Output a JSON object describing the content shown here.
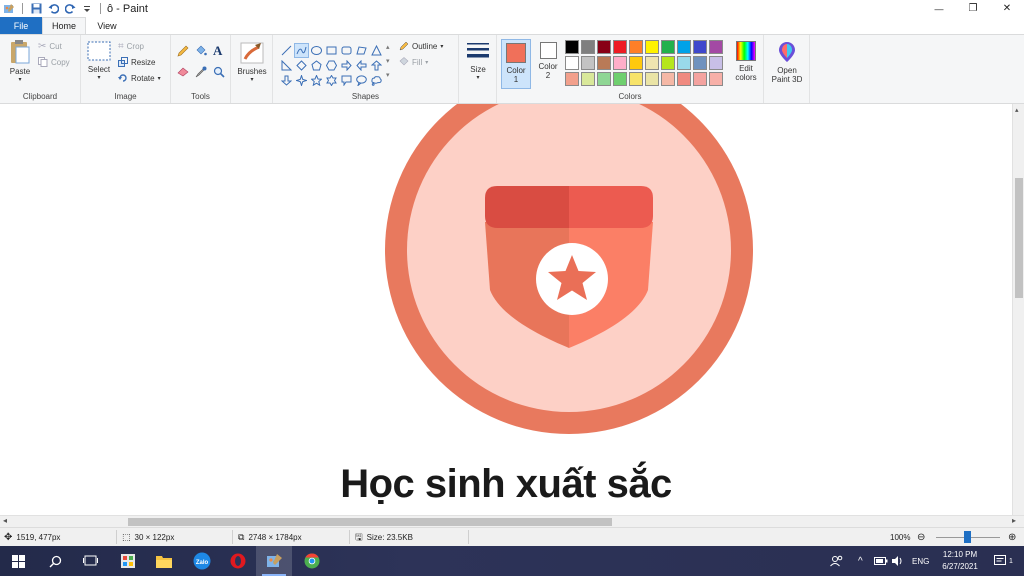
{
  "window": {
    "title": "ô - Paint",
    "controls": {
      "minimize": "—",
      "restore": "❐",
      "close": "✕"
    }
  },
  "tabs": [
    {
      "label": "File"
    },
    {
      "label": "Home"
    },
    {
      "label": "View"
    }
  ],
  "ribbon": {
    "clipboard": {
      "label": "Clipboard",
      "paste": "Paste",
      "cut": "Cut",
      "copy": "Copy"
    },
    "image": {
      "label": "Image",
      "select": "Select",
      "crop": "Crop",
      "resize": "Resize",
      "rotate": "Rotate"
    },
    "tools": {
      "label": "Tools",
      "brushes": "Brushes"
    },
    "shapes": {
      "label": "Shapes",
      "outline": "Outline",
      "fill": "Fill"
    },
    "size": {
      "label": "Size"
    },
    "colors": {
      "label": "Colors",
      "color1": {
        "label": "Color",
        "num": "1",
        "value": "#f0705a"
      },
      "color2": {
        "label": "Color",
        "num": "2",
        "value": "#ffffff"
      },
      "edit_colors": {
        "line1": "Edit",
        "line2": "colors"
      },
      "open_paint3d": {
        "line1": "Open",
        "line2": "Paint 3D"
      },
      "palette": [
        "#000000",
        "#7f7f7f",
        "#880015",
        "#ed1c24",
        "#ff7f27",
        "#fff200",
        "#22b14c",
        "#00a2e8",
        "#3f48cc",
        "#a349a4",
        "#ffffff",
        "#c3c3c3",
        "#b97a57",
        "#ffaec9",
        "#ffc90e",
        "#efe4b0",
        "#b5e61d",
        "#99d9ea",
        "#7092be",
        "#c8bfe7",
        "#f2a08c",
        "#d9e89a",
        "#8fd694",
        "#6fcf6f",
        "#f7e36a",
        "#eae4a6",
        "#f5b8a6",
        "#f08a80",
        "#f4a3a0",
        "#f7b0a8"
      ]
    }
  },
  "canvas": {
    "headline": "Học sinh xuất sắc",
    "badge_colors": {
      "ring": "#e8795e",
      "disc": "#fdd0c6",
      "shield_dark": "#e8755a",
      "shield_light": "#fb7f66",
      "band_dark": "#d94c42",
      "band_light": "#ec5b50",
      "star": "#ea6f57"
    }
  },
  "status": {
    "cursor_pos": "1519, 477px",
    "selection_size": "30 × 122px",
    "image_size": "2748 × 1784px",
    "file_size": "Size: 23.5KB",
    "zoom": "100%"
  },
  "taskbar": {
    "apps": [
      "start-icon",
      "search-icon",
      "task-view-icon",
      "app-store-icon",
      "file-explorer-icon",
      "zalo-icon",
      "opera-icon",
      "paint-icon",
      "chrome-icon"
    ],
    "lang": "ENG",
    "time": "12:10 PM",
    "date": "6/27/2021",
    "notification_count": "1"
  }
}
